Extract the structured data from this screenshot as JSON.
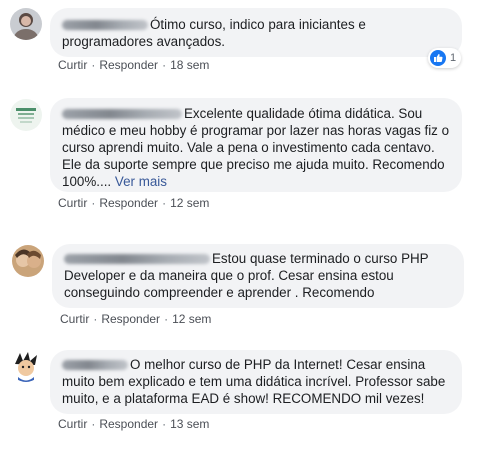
{
  "comments": [
    {
      "text": "Ótimo curso, indico para iniciantes e programadores avançados.",
      "more": "",
      "actions": {
        "like": "Curtir",
        "reply": "Responder",
        "time": "18 sem"
      },
      "reactions": {
        "icon": "like-icon",
        "count": "1"
      }
    },
    {
      "text": "Excelente qualidade ótima didática. Sou médico e meu hobby é programar por lazer nas horas vagas fiz o curso aprendi muito. Vale a pena o investimento cada centavo. Ele da suporte sempre que preciso me ajuda muito. Recomendo 100%....",
      "more": "Ver mais",
      "actions": {
        "like": "Curtir",
        "reply": "Responder",
        "time": "12 sem"
      }
    },
    {
      "text": "Estou quase terminado o curso PHP Developer e da maneira que o prof. Cesar ensina estou conseguindo compreender e aprender . Recomendo",
      "more": "",
      "actions": {
        "like": "Curtir",
        "reply": "Responder",
        "time": "12 sem"
      }
    },
    {
      "text": "O melhor curso de PHP da Internet! Cesar ensina muito bem explicado e tem uma didática incrível. Professor sabe muito, e a plataforma EAD é show! RECOMENDO mil vezes!",
      "more": "",
      "actions": {
        "like": "Curtir",
        "reply": "Responder",
        "time": "13 sem"
      }
    }
  ],
  "colors": {
    "bubble": "#f2f3f5",
    "link": "#385898",
    "meta": "#606770",
    "like": "#1877f2"
  }
}
